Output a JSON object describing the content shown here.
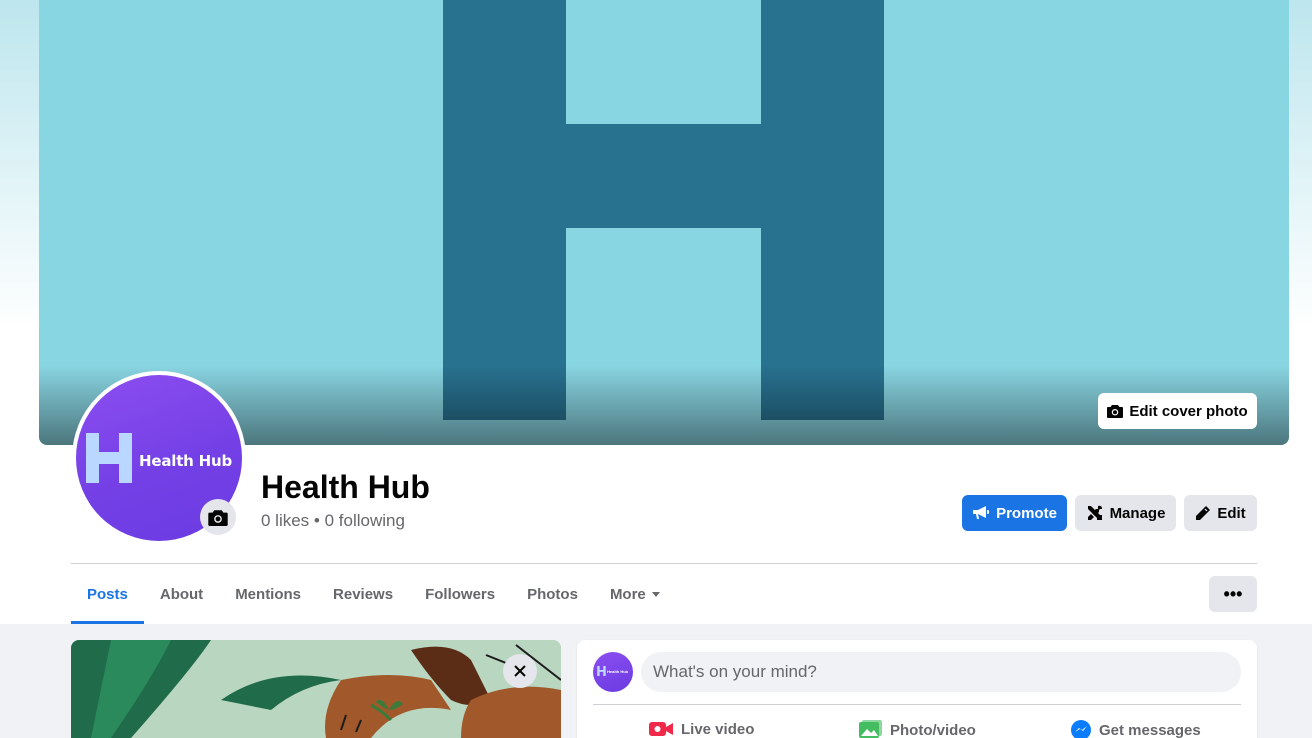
{
  "page": {
    "name": "Health Hub",
    "likes": "0 likes",
    "separator": "•",
    "following": "0 following"
  },
  "profile_picture": {
    "logo_text": "Health Hub",
    "logo_letter": "H"
  },
  "cover": {
    "edit_label": "Edit cover photo",
    "colors": {
      "background": "#89d6e3",
      "letter": "#287290"
    }
  },
  "buttons": {
    "promote": "Promote",
    "manage": "Manage",
    "edit": "Edit"
  },
  "tabs": [
    {
      "label": "Posts",
      "active": true
    },
    {
      "label": "About",
      "active": false
    },
    {
      "label": "Mentions",
      "active": false
    },
    {
      "label": "Reviews",
      "active": false
    },
    {
      "label": "Followers",
      "active": false
    },
    {
      "label": "Photos",
      "active": false
    },
    {
      "label": "More",
      "active": false
    }
  ],
  "tabs_overflow": "•••",
  "composer": {
    "placeholder": "What's on your mind?",
    "actions": [
      "Live video",
      "Photo/video",
      "Get messages"
    ]
  },
  "icons": [
    "camera-icon",
    "megaphone-icon",
    "tools-icon",
    "pencil-icon",
    "close-icon",
    "live-video-icon",
    "photo-icon",
    "messenger-icon"
  ],
  "colors": {
    "accent": "#1b74e4",
    "avatar": "#7a44ea"
  }
}
